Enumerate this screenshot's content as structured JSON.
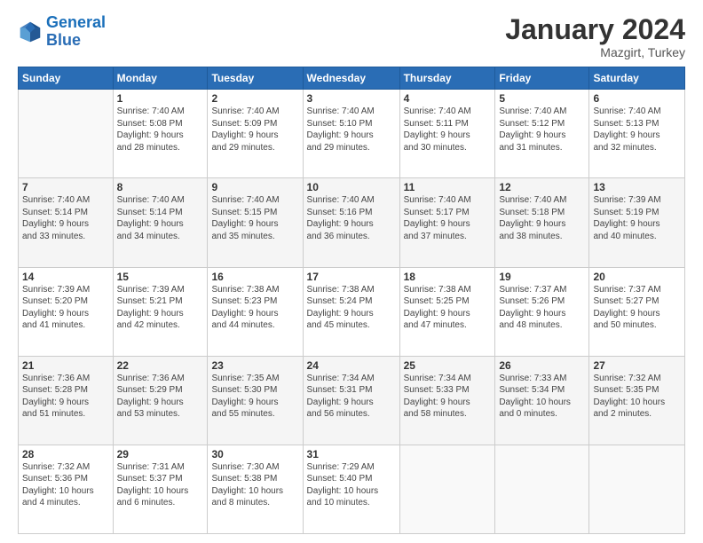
{
  "header": {
    "logo_line1": "General",
    "logo_line2": "Blue",
    "title": "January 2024",
    "subtitle": "Mazgirt, Turkey"
  },
  "days_of_week": [
    "Sunday",
    "Monday",
    "Tuesday",
    "Wednesday",
    "Thursday",
    "Friday",
    "Saturday"
  ],
  "weeks": [
    [
      {
        "day": "",
        "sunrise": "",
        "sunset": "",
        "daylight": ""
      },
      {
        "day": "1",
        "sunrise": "Sunrise: 7:40 AM",
        "sunset": "Sunset: 5:08 PM",
        "daylight": "Daylight: 9 hours and 28 minutes."
      },
      {
        "day": "2",
        "sunrise": "Sunrise: 7:40 AM",
        "sunset": "Sunset: 5:09 PM",
        "daylight": "Daylight: 9 hours and 29 minutes."
      },
      {
        "day": "3",
        "sunrise": "Sunrise: 7:40 AM",
        "sunset": "Sunset: 5:10 PM",
        "daylight": "Daylight: 9 hours and 29 minutes."
      },
      {
        "day": "4",
        "sunrise": "Sunrise: 7:40 AM",
        "sunset": "Sunset: 5:11 PM",
        "daylight": "Daylight: 9 hours and 30 minutes."
      },
      {
        "day": "5",
        "sunrise": "Sunrise: 7:40 AM",
        "sunset": "Sunset: 5:12 PM",
        "daylight": "Daylight: 9 hours and 31 minutes."
      },
      {
        "day": "6",
        "sunrise": "Sunrise: 7:40 AM",
        "sunset": "Sunset: 5:13 PM",
        "daylight": "Daylight: 9 hours and 32 minutes."
      }
    ],
    [
      {
        "day": "7",
        "sunrise": "Sunrise: 7:40 AM",
        "sunset": "Sunset: 5:14 PM",
        "daylight": "Daylight: 9 hours and 33 minutes."
      },
      {
        "day": "8",
        "sunrise": "Sunrise: 7:40 AM",
        "sunset": "Sunset: 5:14 PM",
        "daylight": "Daylight: 9 hours and 34 minutes."
      },
      {
        "day": "9",
        "sunrise": "Sunrise: 7:40 AM",
        "sunset": "Sunset: 5:15 PM",
        "daylight": "Daylight: 9 hours and 35 minutes."
      },
      {
        "day": "10",
        "sunrise": "Sunrise: 7:40 AM",
        "sunset": "Sunset: 5:16 PM",
        "daylight": "Daylight: 9 hours and 36 minutes."
      },
      {
        "day": "11",
        "sunrise": "Sunrise: 7:40 AM",
        "sunset": "Sunset: 5:17 PM",
        "daylight": "Daylight: 9 hours and 37 minutes."
      },
      {
        "day": "12",
        "sunrise": "Sunrise: 7:40 AM",
        "sunset": "Sunset: 5:18 PM",
        "daylight": "Daylight: 9 hours and 38 minutes."
      },
      {
        "day": "13",
        "sunrise": "Sunrise: 7:39 AM",
        "sunset": "Sunset: 5:19 PM",
        "daylight": "Daylight: 9 hours and 40 minutes."
      }
    ],
    [
      {
        "day": "14",
        "sunrise": "Sunrise: 7:39 AM",
        "sunset": "Sunset: 5:20 PM",
        "daylight": "Daylight: 9 hours and 41 minutes."
      },
      {
        "day": "15",
        "sunrise": "Sunrise: 7:39 AM",
        "sunset": "Sunset: 5:21 PM",
        "daylight": "Daylight: 9 hours and 42 minutes."
      },
      {
        "day": "16",
        "sunrise": "Sunrise: 7:38 AM",
        "sunset": "Sunset: 5:23 PM",
        "daylight": "Daylight: 9 hours and 44 minutes."
      },
      {
        "day": "17",
        "sunrise": "Sunrise: 7:38 AM",
        "sunset": "Sunset: 5:24 PM",
        "daylight": "Daylight: 9 hours and 45 minutes."
      },
      {
        "day": "18",
        "sunrise": "Sunrise: 7:38 AM",
        "sunset": "Sunset: 5:25 PM",
        "daylight": "Daylight: 9 hours and 47 minutes."
      },
      {
        "day": "19",
        "sunrise": "Sunrise: 7:37 AM",
        "sunset": "Sunset: 5:26 PM",
        "daylight": "Daylight: 9 hours and 48 minutes."
      },
      {
        "day": "20",
        "sunrise": "Sunrise: 7:37 AM",
        "sunset": "Sunset: 5:27 PM",
        "daylight": "Daylight: 9 hours and 50 minutes."
      }
    ],
    [
      {
        "day": "21",
        "sunrise": "Sunrise: 7:36 AM",
        "sunset": "Sunset: 5:28 PM",
        "daylight": "Daylight: 9 hours and 51 minutes."
      },
      {
        "day": "22",
        "sunrise": "Sunrise: 7:36 AM",
        "sunset": "Sunset: 5:29 PM",
        "daylight": "Daylight: 9 hours and 53 minutes."
      },
      {
        "day": "23",
        "sunrise": "Sunrise: 7:35 AM",
        "sunset": "Sunset: 5:30 PM",
        "daylight": "Daylight: 9 hours and 55 minutes."
      },
      {
        "day": "24",
        "sunrise": "Sunrise: 7:34 AM",
        "sunset": "Sunset: 5:31 PM",
        "daylight": "Daylight: 9 hours and 56 minutes."
      },
      {
        "day": "25",
        "sunrise": "Sunrise: 7:34 AM",
        "sunset": "Sunset: 5:33 PM",
        "daylight": "Daylight: 9 hours and 58 minutes."
      },
      {
        "day": "26",
        "sunrise": "Sunrise: 7:33 AM",
        "sunset": "Sunset: 5:34 PM",
        "daylight": "Daylight: 10 hours and 0 minutes."
      },
      {
        "day": "27",
        "sunrise": "Sunrise: 7:32 AM",
        "sunset": "Sunset: 5:35 PM",
        "daylight": "Daylight: 10 hours and 2 minutes."
      }
    ],
    [
      {
        "day": "28",
        "sunrise": "Sunrise: 7:32 AM",
        "sunset": "Sunset: 5:36 PM",
        "daylight": "Daylight: 10 hours and 4 minutes."
      },
      {
        "day": "29",
        "sunrise": "Sunrise: 7:31 AM",
        "sunset": "Sunset: 5:37 PM",
        "daylight": "Daylight: 10 hours and 6 minutes."
      },
      {
        "day": "30",
        "sunrise": "Sunrise: 7:30 AM",
        "sunset": "Sunset: 5:38 PM",
        "daylight": "Daylight: 10 hours and 8 minutes."
      },
      {
        "day": "31",
        "sunrise": "Sunrise: 7:29 AM",
        "sunset": "Sunset: 5:40 PM",
        "daylight": "Daylight: 10 hours and 10 minutes."
      },
      {
        "day": "",
        "sunrise": "",
        "sunset": "",
        "daylight": ""
      },
      {
        "day": "",
        "sunrise": "",
        "sunset": "",
        "daylight": ""
      },
      {
        "day": "",
        "sunrise": "",
        "sunset": "",
        "daylight": ""
      }
    ]
  ]
}
